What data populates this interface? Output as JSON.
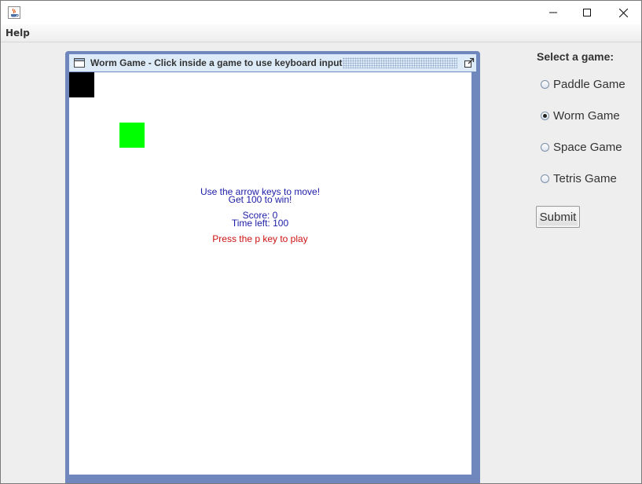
{
  "menu": {
    "help": "Help"
  },
  "internal_frame": {
    "title": "Worm Game - Click inside a game to use keyboard input"
  },
  "game": {
    "instructions_line1": "Use the arrow keys to move!",
    "instructions_line2": "Get 100 to win!",
    "score_text": "Score: 0",
    "time_text": "Time left: 100",
    "play_prompt": "Press the p key to play",
    "colors": {
      "worm": "#000000",
      "food": "#00ff00",
      "info_text": "#1c1ca8",
      "prompt_text": "#cc1111"
    }
  },
  "selector": {
    "label": "Select a game:",
    "options": [
      {
        "label": "Paddle Game",
        "selected": false
      },
      {
        "label": "Worm Game",
        "selected": true
      },
      {
        "label": "Space Game",
        "selected": false
      },
      {
        "label": "Tetris Game",
        "selected": false
      }
    ],
    "submit_label": "Submit"
  },
  "icons": {
    "app": "java-coffee-icon",
    "minimize": "minimize-icon",
    "maximize": "maximize-icon",
    "close": "close-icon",
    "frame": "window-frame-icon",
    "frame_maximize": "external-maximize-icon"
  }
}
